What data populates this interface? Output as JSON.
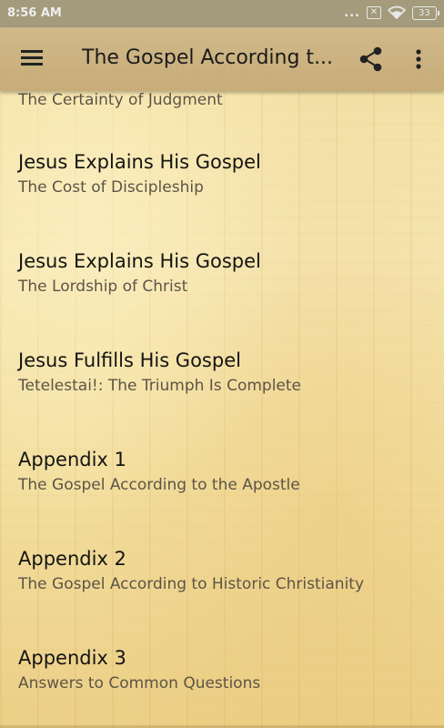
{
  "status_bar": {
    "time": "8:56 AM",
    "dots": "...",
    "battery": "33",
    "icons": [
      "sim-x-icon",
      "wifi-icon",
      "battery-icon"
    ]
  },
  "app_bar": {
    "title": "The Gospel According t...",
    "icons": [
      "menu-icon",
      "share-icon",
      "more-vert-icon"
    ]
  },
  "list": {
    "items": [
      {
        "title": "",
        "subtitle": "The Certainty of Judgment"
      },
      {
        "title": "Jesus Explains His Gospel",
        "subtitle": "The Cost of Discipleship"
      },
      {
        "title": "Jesus Explains His Gospel",
        "subtitle": "The Lordship of Christ"
      },
      {
        "title": "Jesus Fulfills His Gospel",
        "subtitle": "Tetelestai!: The Triumph Is Complete"
      },
      {
        "title": "Appendix 1",
        "subtitle": "The Gospel According to the Apostle"
      },
      {
        "title": "Appendix 2",
        "subtitle": "The Gospel According to Historic Christianity"
      },
      {
        "title": "Appendix 3",
        "subtitle": "Answers to Common Questions"
      }
    ]
  },
  "colors": {
    "status_bar_bg": "#a39b7c",
    "app_bar_bg": "#cdb382",
    "parchment": "#f5e3a8",
    "title_text": "#141414",
    "subtitle_text": "#5c5447"
  }
}
